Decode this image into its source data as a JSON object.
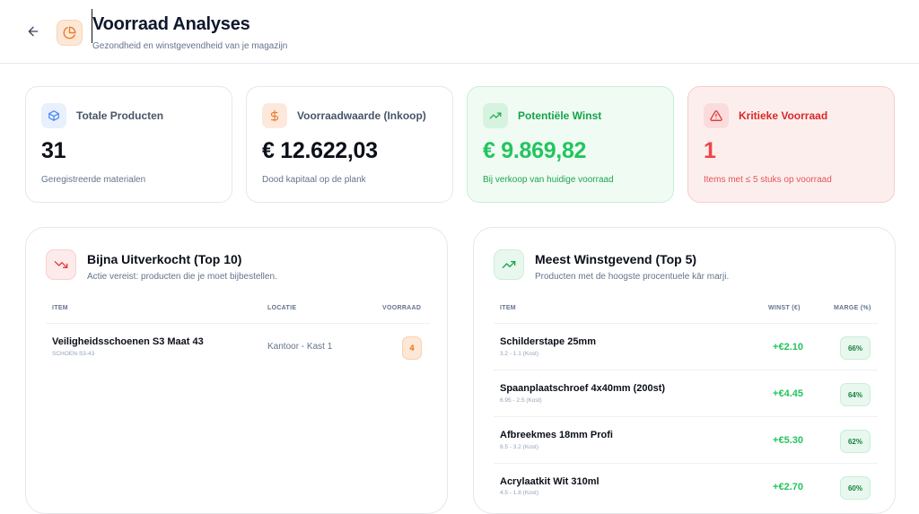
{
  "header": {
    "title": "Voorraad Analyses",
    "subtitle": "Gezondheid en winstgevendheid van je magazijn",
    "back_icon": "arrow-left-icon",
    "logo_icon": "pie-chart-icon"
  },
  "stats": [
    {
      "icon": "box-icon",
      "label": "Totale Producten",
      "value": "31",
      "note": "Geregistreerde materialen"
    },
    {
      "icon": "dollar-icon",
      "label": "Voorraadwaarde (Inkoop)",
      "value": "€ 12.622,03",
      "note": "Dood kapitaal op de plank"
    },
    {
      "icon": "trending-up-icon",
      "label": "Potentiële Winst",
      "value": "€ 9.869,82",
      "note": "Bij verkoop van huidige voorraad"
    },
    {
      "icon": "alert-triangle-icon",
      "label": "Kritieke Voorraad",
      "value": "1",
      "note": "Items met ≤ 5 stuks op voorraad"
    }
  ],
  "low_stock": {
    "title": "Bijna Uitverkocht (Top 10)",
    "subtitle": "Actie vereist: producten die je moet bijbestellen.",
    "icon": "trending-down-icon",
    "columns": {
      "item": "ITEM",
      "location": "LOCATIE",
      "stock": "VOORRAAD"
    },
    "rows": [
      {
        "name": "Veiligheidsschoenen S3 Maat 43",
        "sku": "SCHOEN-S3-43",
        "location": "Kantoor - Kast 1",
        "stock": "4"
      }
    ]
  },
  "top_profit": {
    "title": "Meest Winstgevend (Top 5)",
    "subtitle": "Producten met de hoogste procentuele kār marji.",
    "icon": "trending-up-icon",
    "columns": {
      "item": "ITEM",
      "profit": "WINST (€)",
      "margin": "MARGE (%)"
    },
    "rows": [
      {
        "name": "Schilderstape 25mm",
        "detail": "3.2 - 1.1 (Kost)",
        "profit": "+€2.10",
        "margin": "66%"
      },
      {
        "name": "Spaanplaatschroef 4x40mm (200st)",
        "detail": "6.95 - 2.5 (Kost)",
        "profit": "+€4.45",
        "margin": "64%"
      },
      {
        "name": "Afbreekmes 18mm Profi",
        "detail": "8.5 - 3.2 (Kost)",
        "profit": "+€5.30",
        "margin": "62%"
      },
      {
        "name": "Acrylaatkit Wit 310ml",
        "detail": "4.5 - 1.8 (Kost)",
        "profit": "+€2.70",
        "margin": "60%"
      }
    ]
  }
}
